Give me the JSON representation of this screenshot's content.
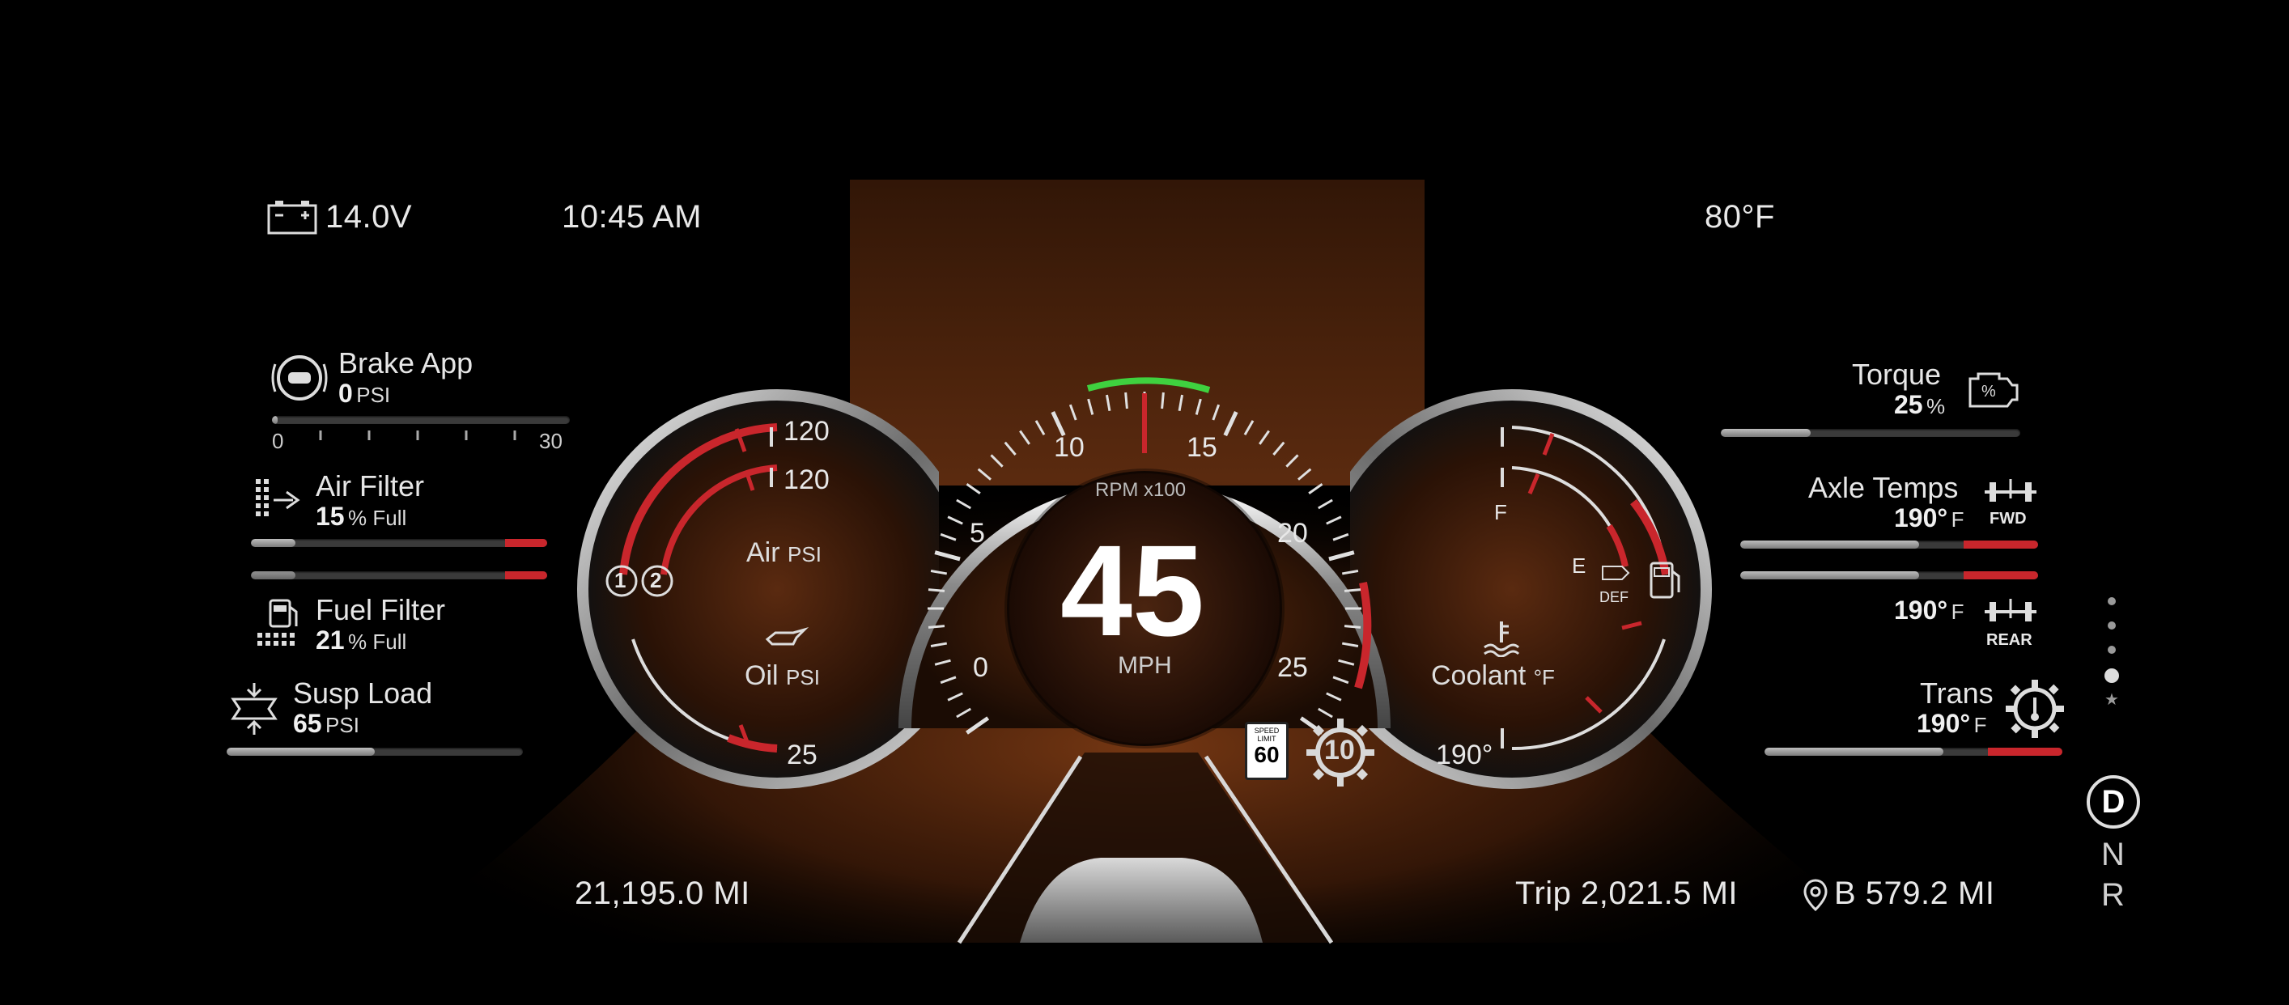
{
  "status_bar": {
    "voltage": "14.0V",
    "time": "10:45 AM",
    "temperature": "80°F"
  },
  "left_panel": {
    "brake_app": {
      "label": "Brake App",
      "value": "0",
      "unit": "PSI",
      "scale_min": "0",
      "scale_max": "30",
      "fill": 0.02
    },
    "air_filter": {
      "label": "Air Filter",
      "value": "15",
      "unit": "% Full",
      "fill": 0.15
    },
    "fuel_filter": {
      "label": "Fuel Filter",
      "value": "21",
      "unit": "% Full",
      "fill": 0.21
    },
    "susp_load": {
      "label": "Susp Load",
      "value": "65",
      "unit": "PSI",
      "fill": 0.5
    }
  },
  "left_gauge": {
    "air_top": "120",
    "air_mid": "120",
    "air_label": "Air",
    "air_unit": "PSI",
    "oil_label": "Oil",
    "oil_unit": "PSI",
    "oil_mark": "25",
    "circuit_1": "1",
    "circuit_2": "2"
  },
  "center_gauge": {
    "speed": "45",
    "speed_unit": "MPH",
    "rpm_label": "RPM x100",
    "ticks": [
      "0",
      "5",
      "10",
      "15",
      "20",
      "25"
    ],
    "speed_limit_top": "SPEED LIMIT",
    "speed_limit": "60",
    "cruise_gear": "10"
  },
  "right_gauge": {
    "fuel_full": "F",
    "fuel_empty": "E",
    "def_label": "DEF",
    "coolant_label": "Coolant",
    "coolant_unit": "°F",
    "coolant_value": "190°"
  },
  "right_panel": {
    "torque": {
      "label": "Torque",
      "value": "25",
      "unit": "%",
      "fill": 0.3
    },
    "axle_temps": {
      "label": "Axle Temps",
      "fwd_value": "190°",
      "fwd_unit": "F",
      "fwd_tag": "FWD",
      "rear_value": "190°",
      "rear_unit": "F",
      "rear_tag": "REAR",
      "fwd_fill": 0.6,
      "rear_fill": 0.6
    },
    "trans": {
      "label": "Trans",
      "value": "190°",
      "unit": "F",
      "fill": 0.6
    }
  },
  "odometer": "21,195.0 MI",
  "trip": "Trip 2,021.5 MI",
  "range": "B 579.2 MI",
  "gears": {
    "drive": "D",
    "neutral": "N",
    "reverse": "R"
  },
  "colors": {
    "accent_red": "#c9262c",
    "green_rpm": "#3fd13f",
    "road_amber": "#7a3410"
  }
}
